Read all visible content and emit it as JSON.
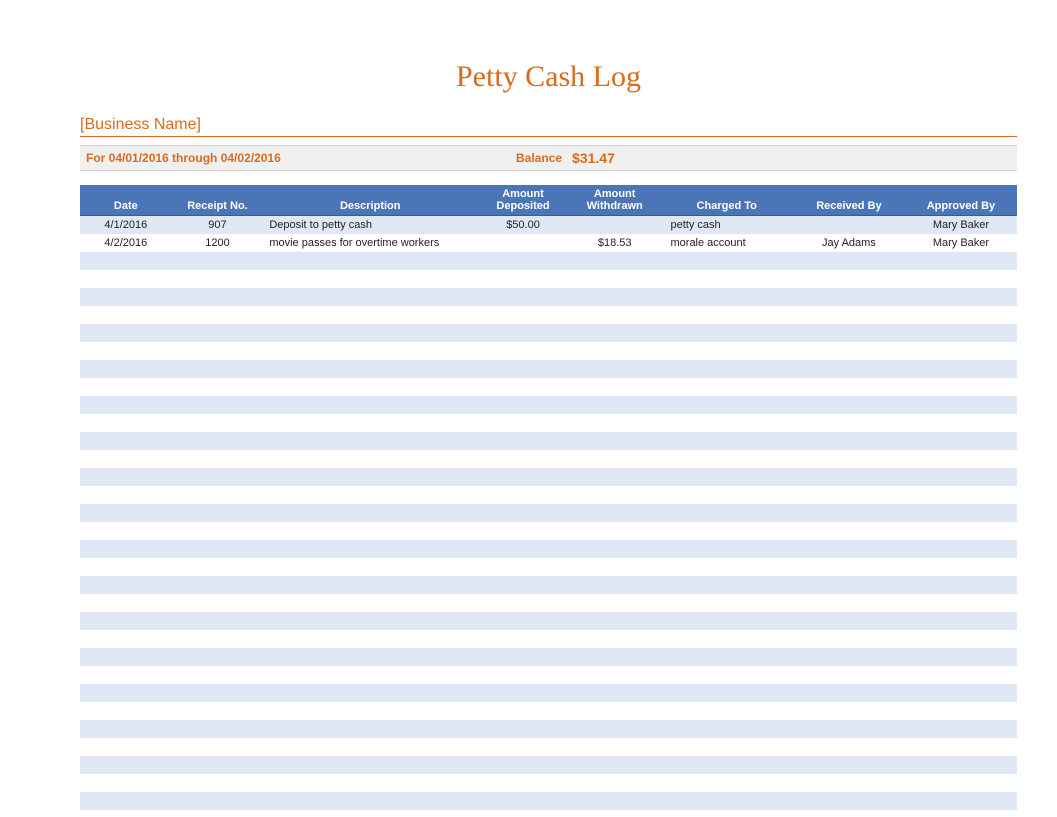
{
  "title": "Petty Cash Log",
  "business_name": "[Business Name]",
  "period_text": "For 04/01/2016 through 04/02/2016",
  "balance_label": "Balance",
  "balance_value": "$31.47",
  "columns": {
    "date": "Date",
    "receipt": "Receipt No.",
    "description": "Description",
    "deposited": "Amount Deposited",
    "withdrawn": "Amount Withdrawn",
    "charged": "Charged To",
    "received": "Received By",
    "approved": "Approved By"
  },
  "rows": [
    {
      "date": "4/1/2016",
      "receipt": "907",
      "description": "Deposit to petty cash",
      "deposited": "$50.00",
      "withdrawn": "",
      "charged": "petty cash",
      "received": "",
      "approved": "Mary Baker"
    },
    {
      "date": "4/2/2016",
      "receipt": "1200",
      "description": "movie passes for overtime workers",
      "deposited": "",
      "withdrawn": "$18.53",
      "charged": "morale account",
      "received": "Jay Adams",
      "approved": "Mary Baker"
    },
    {
      "date": "",
      "receipt": "",
      "description": "",
      "deposited": "",
      "withdrawn": "",
      "charged": "",
      "received": "",
      "approved": ""
    },
    {
      "date": "",
      "receipt": "",
      "description": "",
      "deposited": "",
      "withdrawn": "",
      "charged": "",
      "received": "",
      "approved": ""
    },
    {
      "date": "",
      "receipt": "",
      "description": "",
      "deposited": "",
      "withdrawn": "",
      "charged": "",
      "received": "",
      "approved": ""
    },
    {
      "date": "",
      "receipt": "",
      "description": "",
      "deposited": "",
      "withdrawn": "",
      "charged": "",
      "received": "",
      "approved": ""
    },
    {
      "date": "",
      "receipt": "",
      "description": "",
      "deposited": "",
      "withdrawn": "",
      "charged": "",
      "received": "",
      "approved": ""
    },
    {
      "date": "",
      "receipt": "",
      "description": "",
      "deposited": "",
      "withdrawn": "",
      "charged": "",
      "received": "",
      "approved": ""
    },
    {
      "date": "",
      "receipt": "",
      "description": "",
      "deposited": "",
      "withdrawn": "",
      "charged": "",
      "received": "",
      "approved": ""
    },
    {
      "date": "",
      "receipt": "",
      "description": "",
      "deposited": "",
      "withdrawn": "",
      "charged": "",
      "received": "",
      "approved": ""
    },
    {
      "date": "",
      "receipt": "",
      "description": "",
      "deposited": "",
      "withdrawn": "",
      "charged": "",
      "received": "",
      "approved": ""
    },
    {
      "date": "",
      "receipt": "",
      "description": "",
      "deposited": "",
      "withdrawn": "",
      "charged": "",
      "received": "",
      "approved": ""
    },
    {
      "date": "",
      "receipt": "",
      "description": "",
      "deposited": "",
      "withdrawn": "",
      "charged": "",
      "received": "",
      "approved": ""
    },
    {
      "date": "",
      "receipt": "",
      "description": "",
      "deposited": "",
      "withdrawn": "",
      "charged": "",
      "received": "",
      "approved": ""
    },
    {
      "date": "",
      "receipt": "",
      "description": "",
      "deposited": "",
      "withdrawn": "",
      "charged": "",
      "received": "",
      "approved": ""
    },
    {
      "date": "",
      "receipt": "",
      "description": "",
      "deposited": "",
      "withdrawn": "",
      "charged": "",
      "received": "",
      "approved": ""
    },
    {
      "date": "",
      "receipt": "",
      "description": "",
      "deposited": "",
      "withdrawn": "",
      "charged": "",
      "received": "",
      "approved": ""
    },
    {
      "date": "",
      "receipt": "",
      "description": "",
      "deposited": "",
      "withdrawn": "",
      "charged": "",
      "received": "",
      "approved": ""
    },
    {
      "date": "",
      "receipt": "",
      "description": "",
      "deposited": "",
      "withdrawn": "",
      "charged": "",
      "received": "",
      "approved": ""
    },
    {
      "date": "",
      "receipt": "",
      "description": "",
      "deposited": "",
      "withdrawn": "",
      "charged": "",
      "received": "",
      "approved": ""
    },
    {
      "date": "",
      "receipt": "",
      "description": "",
      "deposited": "",
      "withdrawn": "",
      "charged": "",
      "received": "",
      "approved": ""
    },
    {
      "date": "",
      "receipt": "",
      "description": "",
      "deposited": "",
      "withdrawn": "",
      "charged": "",
      "received": "",
      "approved": ""
    },
    {
      "date": "",
      "receipt": "",
      "description": "",
      "deposited": "",
      "withdrawn": "",
      "charged": "",
      "received": "",
      "approved": ""
    },
    {
      "date": "",
      "receipt": "",
      "description": "",
      "deposited": "",
      "withdrawn": "",
      "charged": "",
      "received": "",
      "approved": ""
    },
    {
      "date": "",
      "receipt": "",
      "description": "",
      "deposited": "",
      "withdrawn": "",
      "charged": "",
      "received": "",
      "approved": ""
    },
    {
      "date": "",
      "receipt": "",
      "description": "",
      "deposited": "",
      "withdrawn": "",
      "charged": "",
      "received": "",
      "approved": ""
    },
    {
      "date": "",
      "receipt": "",
      "description": "",
      "deposited": "",
      "withdrawn": "",
      "charged": "",
      "received": "",
      "approved": ""
    },
    {
      "date": "",
      "receipt": "",
      "description": "",
      "deposited": "",
      "withdrawn": "",
      "charged": "",
      "received": "",
      "approved": ""
    },
    {
      "date": "",
      "receipt": "",
      "description": "",
      "deposited": "",
      "withdrawn": "",
      "charged": "",
      "received": "",
      "approved": ""
    },
    {
      "date": "",
      "receipt": "",
      "description": "",
      "deposited": "",
      "withdrawn": "",
      "charged": "",
      "received": "",
      "approved": ""
    },
    {
      "date": "",
      "receipt": "",
      "description": "",
      "deposited": "",
      "withdrawn": "",
      "charged": "",
      "received": "",
      "approved": ""
    },
    {
      "date": "",
      "receipt": "",
      "description": "",
      "deposited": "",
      "withdrawn": "",
      "charged": "",
      "received": "",
      "approved": ""
    },
    {
      "date": "",
      "receipt": "",
      "description": "",
      "deposited": "",
      "withdrawn": "",
      "charged": "",
      "received": "",
      "approved": ""
    }
  ]
}
